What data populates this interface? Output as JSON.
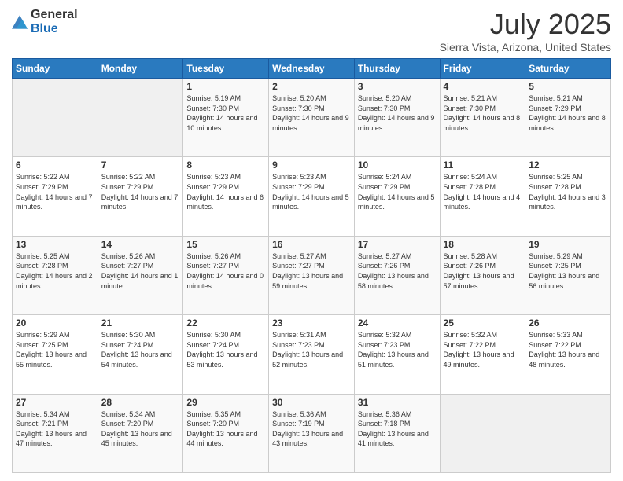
{
  "logo": {
    "general": "General",
    "blue": "Blue"
  },
  "header": {
    "title": "July 2025",
    "subtitle": "Sierra Vista, Arizona, United States"
  },
  "days_of_week": [
    "Sunday",
    "Monday",
    "Tuesday",
    "Wednesday",
    "Thursday",
    "Friday",
    "Saturday"
  ],
  "weeks": [
    [
      {
        "day": "",
        "info": ""
      },
      {
        "day": "",
        "info": ""
      },
      {
        "day": "1",
        "info": "Sunrise: 5:19 AM\nSunset: 7:30 PM\nDaylight: 14 hours and 10 minutes."
      },
      {
        "day": "2",
        "info": "Sunrise: 5:20 AM\nSunset: 7:30 PM\nDaylight: 14 hours and 9 minutes."
      },
      {
        "day": "3",
        "info": "Sunrise: 5:20 AM\nSunset: 7:30 PM\nDaylight: 14 hours and 9 minutes."
      },
      {
        "day": "4",
        "info": "Sunrise: 5:21 AM\nSunset: 7:30 PM\nDaylight: 14 hours and 8 minutes."
      },
      {
        "day": "5",
        "info": "Sunrise: 5:21 AM\nSunset: 7:29 PM\nDaylight: 14 hours and 8 minutes."
      }
    ],
    [
      {
        "day": "6",
        "info": "Sunrise: 5:22 AM\nSunset: 7:29 PM\nDaylight: 14 hours and 7 minutes."
      },
      {
        "day": "7",
        "info": "Sunrise: 5:22 AM\nSunset: 7:29 PM\nDaylight: 14 hours and 7 minutes."
      },
      {
        "day": "8",
        "info": "Sunrise: 5:23 AM\nSunset: 7:29 PM\nDaylight: 14 hours and 6 minutes."
      },
      {
        "day": "9",
        "info": "Sunrise: 5:23 AM\nSunset: 7:29 PM\nDaylight: 14 hours and 5 minutes."
      },
      {
        "day": "10",
        "info": "Sunrise: 5:24 AM\nSunset: 7:29 PM\nDaylight: 14 hours and 5 minutes."
      },
      {
        "day": "11",
        "info": "Sunrise: 5:24 AM\nSunset: 7:28 PM\nDaylight: 14 hours and 4 minutes."
      },
      {
        "day": "12",
        "info": "Sunrise: 5:25 AM\nSunset: 7:28 PM\nDaylight: 14 hours and 3 minutes."
      }
    ],
    [
      {
        "day": "13",
        "info": "Sunrise: 5:25 AM\nSunset: 7:28 PM\nDaylight: 14 hours and 2 minutes."
      },
      {
        "day": "14",
        "info": "Sunrise: 5:26 AM\nSunset: 7:27 PM\nDaylight: 14 hours and 1 minute."
      },
      {
        "day": "15",
        "info": "Sunrise: 5:26 AM\nSunset: 7:27 PM\nDaylight: 14 hours and 0 minutes."
      },
      {
        "day": "16",
        "info": "Sunrise: 5:27 AM\nSunset: 7:27 PM\nDaylight: 13 hours and 59 minutes."
      },
      {
        "day": "17",
        "info": "Sunrise: 5:27 AM\nSunset: 7:26 PM\nDaylight: 13 hours and 58 minutes."
      },
      {
        "day": "18",
        "info": "Sunrise: 5:28 AM\nSunset: 7:26 PM\nDaylight: 13 hours and 57 minutes."
      },
      {
        "day": "19",
        "info": "Sunrise: 5:29 AM\nSunset: 7:25 PM\nDaylight: 13 hours and 56 minutes."
      }
    ],
    [
      {
        "day": "20",
        "info": "Sunrise: 5:29 AM\nSunset: 7:25 PM\nDaylight: 13 hours and 55 minutes."
      },
      {
        "day": "21",
        "info": "Sunrise: 5:30 AM\nSunset: 7:24 PM\nDaylight: 13 hours and 54 minutes."
      },
      {
        "day": "22",
        "info": "Sunrise: 5:30 AM\nSunset: 7:24 PM\nDaylight: 13 hours and 53 minutes."
      },
      {
        "day": "23",
        "info": "Sunrise: 5:31 AM\nSunset: 7:23 PM\nDaylight: 13 hours and 52 minutes."
      },
      {
        "day": "24",
        "info": "Sunrise: 5:32 AM\nSunset: 7:23 PM\nDaylight: 13 hours and 51 minutes."
      },
      {
        "day": "25",
        "info": "Sunrise: 5:32 AM\nSunset: 7:22 PM\nDaylight: 13 hours and 49 minutes."
      },
      {
        "day": "26",
        "info": "Sunrise: 5:33 AM\nSunset: 7:22 PM\nDaylight: 13 hours and 48 minutes."
      }
    ],
    [
      {
        "day": "27",
        "info": "Sunrise: 5:34 AM\nSunset: 7:21 PM\nDaylight: 13 hours and 47 minutes."
      },
      {
        "day": "28",
        "info": "Sunrise: 5:34 AM\nSunset: 7:20 PM\nDaylight: 13 hours and 45 minutes."
      },
      {
        "day": "29",
        "info": "Sunrise: 5:35 AM\nSunset: 7:20 PM\nDaylight: 13 hours and 44 minutes."
      },
      {
        "day": "30",
        "info": "Sunrise: 5:36 AM\nSunset: 7:19 PM\nDaylight: 13 hours and 43 minutes."
      },
      {
        "day": "31",
        "info": "Sunrise: 5:36 AM\nSunset: 7:18 PM\nDaylight: 13 hours and 41 minutes."
      },
      {
        "day": "",
        "info": ""
      },
      {
        "day": "",
        "info": ""
      }
    ]
  ]
}
